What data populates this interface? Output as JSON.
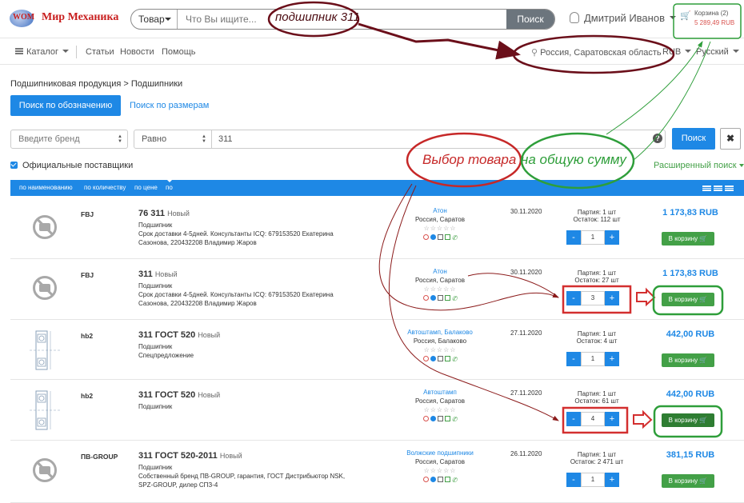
{
  "header": {
    "logo_text": "Мир Механика",
    "logo_badge": "WOM",
    "search_category": "Товар",
    "search_placeholder": "Что Вы ищите...",
    "search_button": "Поиск",
    "user_name": "Дмитрий Иванов",
    "cart_label": "Корзина (2)",
    "cart_total": "5 289,49 RUB"
  },
  "nav": {
    "catalog": "Каталог",
    "items": [
      "Статьи",
      "Новости",
      "Помощь"
    ],
    "region": "Россия, Саратовская область",
    "currency": "RUB",
    "language": "Русский"
  },
  "breadcrumb": "Подшипниковая продукция > Подшипники",
  "tabs": {
    "by_designation": "Поиск по обозначению",
    "by_size": "Поиск по размерам"
  },
  "filters": {
    "brand_placeholder": "Введите бренд",
    "condition": "Равно",
    "query": "311",
    "help": "?",
    "search_button": "Поиск",
    "clear_button": "✖",
    "official_suppliers": "Официальные поставщики",
    "advanced": "Расширенный поиск"
  },
  "sort": {
    "by_name": "по наименованию",
    "by_qty": "по количеству",
    "by_price": "по цене",
    "by_date": "по дате"
  },
  "products": [
    {
      "brand": "FBJ",
      "name": "76 311",
      "badge": "Новый",
      "type": "Подшипник",
      "desc": "Срок доставки 4-5дней. Консультанты ICQ: 679153520 Екатерина Сазонова, 220432208 Владимир Жаров",
      "supplier": "Атон",
      "location": "Россия, Саратов",
      "stars": "☆☆☆☆☆",
      "date": "30.11.2020",
      "batch": "Партия: 1 шт",
      "stock": "Остаток: 112 шт",
      "qty": "1",
      "price": "1 173,83 RUB",
      "cart": "В корзину 🛒"
    },
    {
      "brand": "FBJ",
      "name": "311",
      "badge": "Новый",
      "type": "Подшипник",
      "desc": "Срок доставки 4-5дней. Консультанты ICQ: 679153520 Екатерина Сазонова, 220432208 Владимир Жаров",
      "supplier": "Атон",
      "location": "Россия, Саратов",
      "stars": "☆☆☆☆☆",
      "date": "30.11.2020",
      "batch": "Партия: 1 шт",
      "stock": "Остаток: 27 шт",
      "qty": "3",
      "price": "1 173,83 RUB",
      "cart": "В корзину 🛒"
    },
    {
      "brand": "hb2",
      "name": "311 ГОСТ 520",
      "badge": "Новый",
      "type": "Подшипник",
      "desc": "Спецпредложение",
      "supplier": "Автоштамп, Балаково",
      "location": "Россия, Балаково",
      "stars": "☆☆☆☆☆",
      "date": "27.11.2020",
      "batch": "Партия: 1 шт",
      "stock": "Остаток: 4 шт",
      "qty": "1",
      "price": "442,00 RUB",
      "cart": "В корзину 🛒"
    },
    {
      "brand": "hb2",
      "name": "311 ГОСТ 520",
      "badge": "Новый",
      "type": "Подшипник",
      "desc": "",
      "supplier": "Автоштамп",
      "location": "Россия, Саратов",
      "stars": "☆☆☆☆☆",
      "date": "27.11.2020",
      "batch": "Партия: 1 шт",
      "stock": "Остаток: 61 шт",
      "qty": "4",
      "price": "442,00 RUB",
      "cart": "В корзину 🛒"
    },
    {
      "brand": "ПВ-GROUP",
      "name": "311 ГОСТ 520-2011",
      "badge": "Новый",
      "type": "Подшипник",
      "desc": "Собственный бренд ПВ-GROUP, гарантия, ГОСТ Дистрибьютор NSK, SPZ-GROUP, дилер СПЗ-4",
      "supplier": "Волжские подшипники",
      "location": "Россия, Саратов",
      "stars": "☆☆☆☆☆",
      "date": "26.11.2020",
      "batch": "Партия: 1 шт",
      "stock": "Остаток: 2 471 шт",
      "qty": "1",
      "price": "381,15 RUB",
      "cart": "В корзину 🛒"
    }
  ],
  "annotations": {
    "search_note": "подшипник 311",
    "choose_note": "Выбор товара",
    "sum_note": "на общую сумму"
  },
  "colors": {
    "primary": "#1e88e5",
    "green": "#43a047",
    "annotation_dark": "#6b0f1a",
    "annotation_red": "#d32f2f",
    "annotation_green": "#2e9e3a"
  }
}
